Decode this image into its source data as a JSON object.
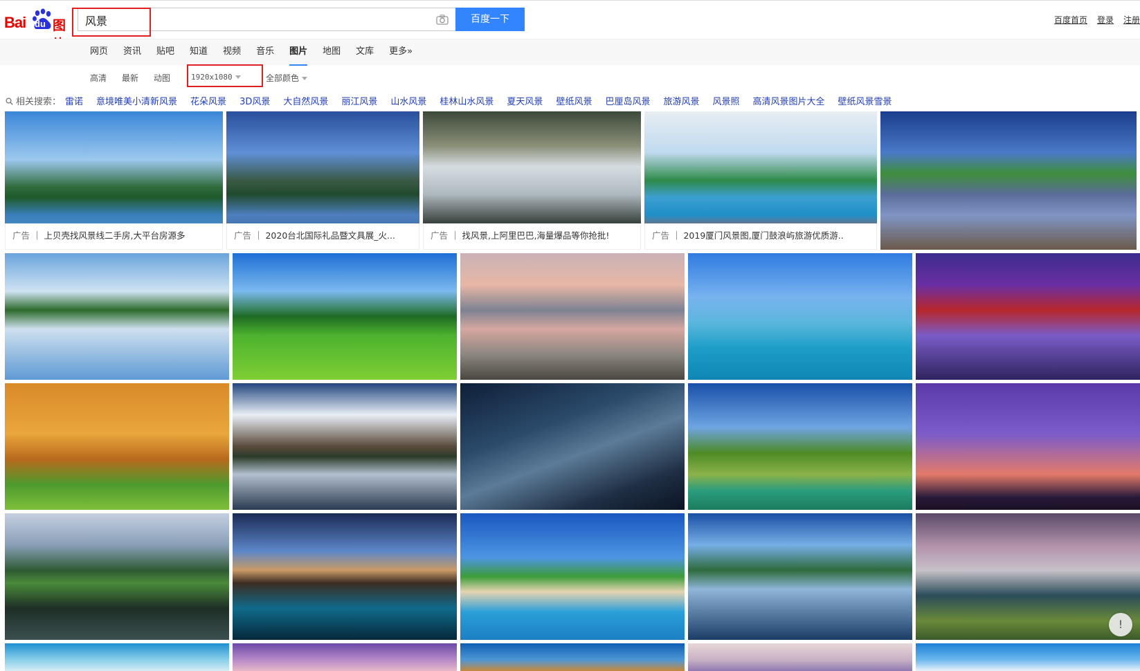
{
  "logo": {
    "bai": "Bai",
    "du": "du",
    "tu": "图片"
  },
  "search": {
    "query": "风景",
    "button": "百度一下"
  },
  "top_links": [
    "百度首页",
    "登录",
    "注册"
  ],
  "nav": {
    "items": [
      "网页",
      "资讯",
      "贴吧",
      "知道",
      "视频",
      "音乐",
      "图片",
      "地图",
      "文库",
      "更多»"
    ],
    "active": "图片"
  },
  "filters": {
    "hd": "高清",
    "latest": "最新",
    "animated": "动图",
    "size": "1920x1080",
    "color": "全部颜色"
  },
  "related": {
    "label": "相关搜索：",
    "terms": [
      "雷诺",
      "意境唯美小清新风景",
      "花朵风景",
      "3D风景",
      "大自然风景",
      "丽江风景",
      "山水风景",
      "桂林山水风景",
      "夏天风景",
      "壁纸风景",
      "巴厘岛风景",
      "旅游风景",
      "风景照",
      "高清风景图片大全",
      "壁纸风景雪景"
    ]
  },
  "ads": [
    {
      "tag": "广告",
      "text": "上贝壳找风景线二手房,大平台房源多"
    },
    {
      "tag": "广告",
      "text": "2020台北国际礼品暨文具展_火..."
    },
    {
      "tag": "广告",
      "text": "找风景,上阿里巴巴,海量爆品等你抢批!"
    },
    {
      "tag": "广告",
      "text": "2019厦门风景图,厦门鼓浪屿旅游优质游.."
    }
  ],
  "feedback": "!",
  "colors": {
    "brand_red": "#e10601",
    "accent_blue": "#3385ff",
    "link_blue": "#2440b3",
    "highlight_red": "#e02020"
  }
}
